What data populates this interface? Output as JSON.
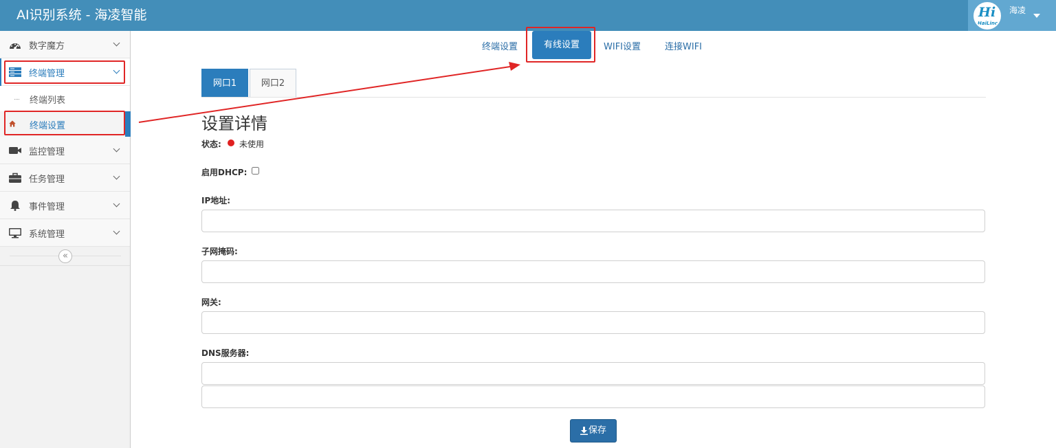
{
  "app": {
    "title": "AI识别系统 - 海凌智能"
  },
  "user": {
    "name": "海凌",
    "logo_text": "Hi",
    "logo_subtext": "HaiLinc"
  },
  "sidebar": {
    "items": [
      {
        "label": "数字魔方",
        "icon": "dashboard-icon"
      },
      {
        "label": "终端管理",
        "icon": "server-icon",
        "open": true,
        "children": [
          {
            "label": "终端列表"
          },
          {
            "label": "终端设置",
            "active": true,
            "icon": "home-icon"
          }
        ]
      },
      {
        "label": "监控管理",
        "icon": "video-camera-icon"
      },
      {
        "label": "任务管理",
        "icon": "briefcase-icon"
      },
      {
        "label": "事件管理",
        "icon": "bell-icon"
      },
      {
        "label": "系统管理",
        "icon": "monitor-icon"
      }
    ],
    "collapse_glyph": "«"
  },
  "top_tabs": [
    {
      "label": "终端设置"
    },
    {
      "label": "有线设置",
      "active": true
    },
    {
      "label": "WIFI设置"
    },
    {
      "label": "连接WIFI"
    }
  ],
  "port_tabs": [
    {
      "label": "网口1",
      "active": true
    },
    {
      "label": "网口2"
    }
  ],
  "form": {
    "title": "设置详情",
    "status_label": "状态:",
    "status_value": "未使用",
    "status_color": "#e02020",
    "dhcp_label": "启用DHCP:",
    "dhcp_checked": false,
    "ip_label": "IP地址:",
    "ip_value": "",
    "mask_label": "子网掩码:",
    "mask_value": "",
    "gateway_label": "网关:",
    "gateway_value": "",
    "dns_label": "DNS服务器:",
    "dns1_value": "",
    "dns2_value": "",
    "save_label": "保存"
  },
  "colors": {
    "topbar": "#438eb9",
    "accent": "#2b7dbc",
    "annotation": "#e02525"
  }
}
